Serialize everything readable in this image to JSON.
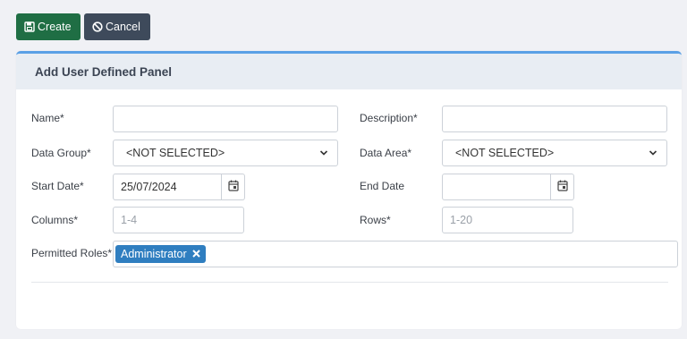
{
  "toolbar": {
    "create_label": "Create",
    "cancel_label": "Cancel"
  },
  "panel": {
    "title": "Add User Defined Panel"
  },
  "form": {
    "name": {
      "label": "Name*",
      "value": ""
    },
    "description": {
      "label": "Description*",
      "value": ""
    },
    "data_group": {
      "label": "Data Group*",
      "selected": "<NOT SELECTED>"
    },
    "data_area": {
      "label": "Data Area*",
      "selected": "<NOT SELECTED>"
    },
    "start_date": {
      "label": "Start Date*",
      "value": "25/07/2024"
    },
    "end_date": {
      "label": "End Date",
      "value": ""
    },
    "columns": {
      "label": "Columns*",
      "placeholder": "1-4"
    },
    "rows": {
      "label": "Rows*",
      "placeholder": "1-20"
    },
    "permitted_roles": {
      "label": "Permitted Roles*",
      "tags": [
        "Administrator"
      ]
    }
  },
  "icons": {
    "create": "save-icon",
    "cancel": "ban-icon",
    "date": "calendar-icon",
    "select": "chevron-down-icon",
    "remove_tag": "close-icon"
  },
  "colors": {
    "create_button": "#1f6e44",
    "cancel_button": "#3e4a5b",
    "panel_accent": "#5aa0e6",
    "tag": "#2f7ec0"
  }
}
